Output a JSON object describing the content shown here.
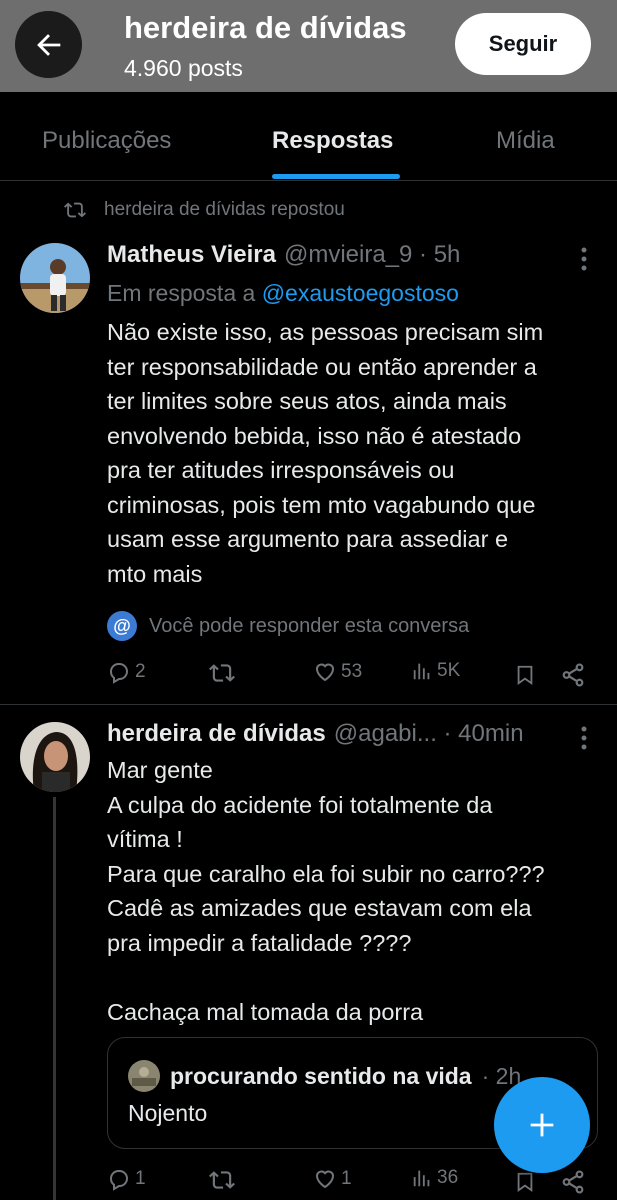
{
  "header": {
    "title": "herdeira de dívidas",
    "posts_count": "4.960 posts",
    "follow_label": "Seguir",
    "back_icon": "arrow-left-icon",
    "background": "#6e6e6e"
  },
  "tabs": [
    {
      "label": "Publicações",
      "active": false
    },
    {
      "label": "Respostas",
      "active": true
    },
    {
      "label": "Mídia",
      "active": false
    }
  ],
  "accent_color": "#1d9bf0",
  "repost_notice": "herdeira de dívidas repostou",
  "post1": {
    "name": "Matheus Vieira",
    "meta": "@mvieira_9 · 5h",
    "reply_prefix": "Em resposta a",
    "reply_mention": "@exaustoegostoso",
    "text": "Não existe isso, as pessoas precisam sim\nter responsabilidade ou então aprender a\nter limites sobre seus atos, ainda mais\nenvolvendo bebida, isso não é atestado\npra ter atitudes irresponsáveis ou\ncriminosas, pois tem mto vagabundo que\nusam esse argumento para assediar e\nmto mais",
    "notice": "Você pode responder esta conversa",
    "actions": {
      "replies": "2",
      "reposts": "",
      "likes": "53",
      "views": "5K"
    }
  },
  "post2": {
    "name": "herdeira de dívidas",
    "meta": "@agabi... · 40min",
    "text": "Mar gente\nA culpa do acidente foi totalmente da\nvítima !\nPara que caralho ela foi subir no carro???\nCadê as amizades que estavam com ela\npra impedir a fatalidade ????\n\nCachaça mal tomada da porra",
    "quote": {
      "name": "procurando sentido na vida",
      "meta": "· 2h",
      "text": "Nojento"
    },
    "actions": {
      "replies": "1",
      "reposts": "",
      "likes": "1",
      "views": "36"
    }
  },
  "fab_icon": "plus-icon"
}
